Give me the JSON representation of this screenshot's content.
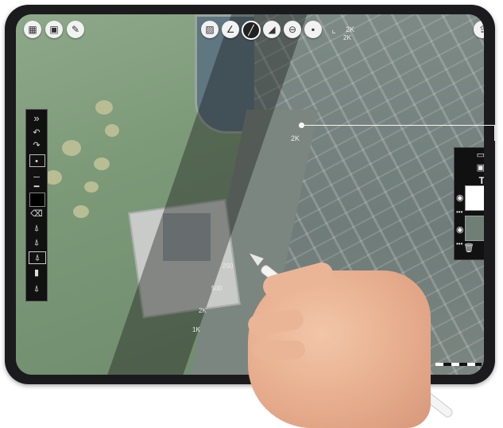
{
  "top_toolbar": {
    "left_icons": [
      "grid-menu-icon",
      "layout-icon",
      "wrench-icon"
    ],
    "center_icons": [
      "hatch-icon",
      "angle-icon",
      "pencil-icon",
      "triangle-icon",
      "minus-circle-icon",
      "square-icon",
      "corner-icon"
    ],
    "right_icons": [
      "share-icon"
    ],
    "center_label": "2K"
  },
  "left_panel": {
    "collapse_label": "»",
    "items": [
      "undo-icon",
      "redo-icon",
      "dot-brush-icon",
      "line-thin-icon",
      "line-thick-icon",
      "swatch-black",
      "eraser-icon",
      "pen-1-icon",
      "pen-2-icon",
      "pen-3-icon",
      "marker-icon",
      "pen-4-icon"
    ]
  },
  "right_panel": {
    "items": [
      "document-icon",
      "image-icon",
      "text-icon"
    ],
    "text_glyph": "T",
    "layers": [
      {
        "icon": "eye-icon",
        "more": "•••",
        "kind": "white"
      },
      {
        "icon": "eye-icon",
        "more": "•••",
        "kind": "map"
      }
    ],
    "delete_icon": "trash-icon"
  },
  "map_labels": {
    "callout": "2K",
    "top": "2K",
    "l250": "250",
    "l500": "500",
    "l2K": "2K",
    "l1K": "1K"
  },
  "colors": {
    "accent_dark": "#111111",
    "map_green": "#7c9a78",
    "water": "#5e7781"
  }
}
